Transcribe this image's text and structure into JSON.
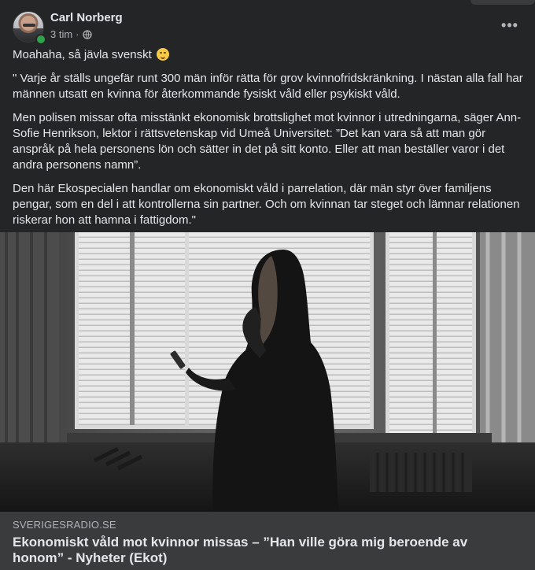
{
  "post": {
    "author": "Carl Norberg",
    "time": "3 tim",
    "separator": "·",
    "paragraphs": [
      "Moahaha, så jävla svenskt",
      "\" Varje år ställs ungefär runt 300 män inför rätta för grov kvinnofridskränkning. I nästan alla fall har männen utsatt en kvinna för återkommande fysiskt våld eller psykiskt våld.",
      "Men polisen missar ofta misstänkt ekonomisk brottslighet mot kvinnor i utredningarna, säger Ann-Sofie Henrikson, lektor i rättsvetenskap vid Umeå Universitet: ”Det kan vara så att man gör anspråk på hela personens lön och sätter in det på sitt konto. Eller att man beställer varor i det andra personens namn”.",
      "Den här Ekospecialen handlar om ekonomiskt våld i parrelation, där män styr över familjens pengar, som en del i att kontrollerna sin partner. Och om kvinnan tar steget och lämnar relationen riskerar hon att hamna i fattigdom.\""
    ],
    "emoji": "winking-smiley-icon"
  },
  "link": {
    "domain": "SVERIGESRADIO.SE",
    "title": "Ekonomiskt våld mot kvinnor missas – ”Han ville göra mig beroende av honom” - Nyheter (Ekot)"
  },
  "colors": {
    "card_bg": "#242526",
    "preview_bg": "#3a3b3c",
    "text_primary": "#e4e6eb",
    "text_secondary": "#b0b3b8",
    "online": "#31a24c"
  }
}
